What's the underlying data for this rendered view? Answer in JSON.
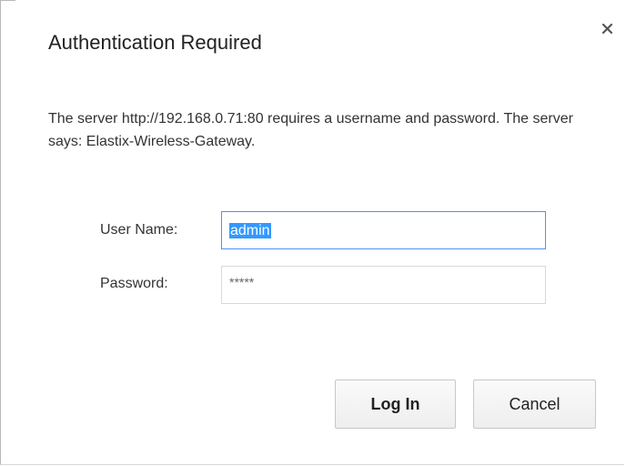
{
  "dialog": {
    "title": "Authentication Required",
    "close_glyph": "×",
    "message": "The server http://192.168.0.71:80 requires a username and password. The server says: Elastix-Wireless-Gateway."
  },
  "form": {
    "username_label": "User Name:",
    "username_value": "admin",
    "password_label": "Password:",
    "password_mask": "*****"
  },
  "buttons": {
    "login_label": "Log In",
    "cancel_label": "Cancel"
  },
  "colors": {
    "focus_border": "#4d90fe",
    "selection": "#3399ff"
  },
  "icons": {
    "close": "close-icon"
  }
}
